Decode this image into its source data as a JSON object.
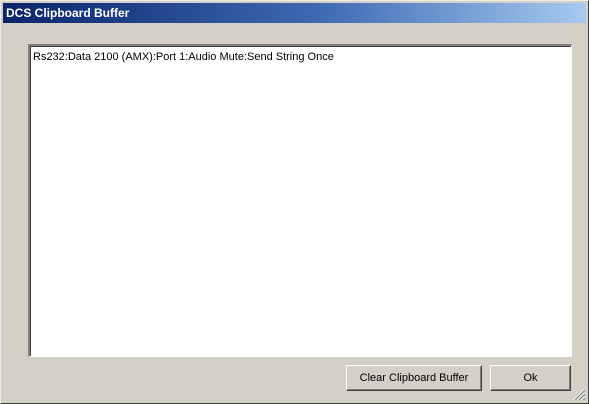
{
  "window": {
    "title": "DCS Clipboard Buffer"
  },
  "buffer": {
    "items": [
      "Rs232:Data 2100 (AMX):Port 1:Audio Mute:Send String Once"
    ]
  },
  "buttons": {
    "clear_label": "Clear Clipboard Buffer",
    "ok_label": "Ok"
  },
  "icons": {
    "resize_grip": "resize-grip-icon"
  },
  "colors": {
    "title_bar_start": "#0a246a",
    "title_bar_end": "#a6caf0",
    "dialog_face": "#d4d0c8",
    "list_background": "#ffffff"
  }
}
